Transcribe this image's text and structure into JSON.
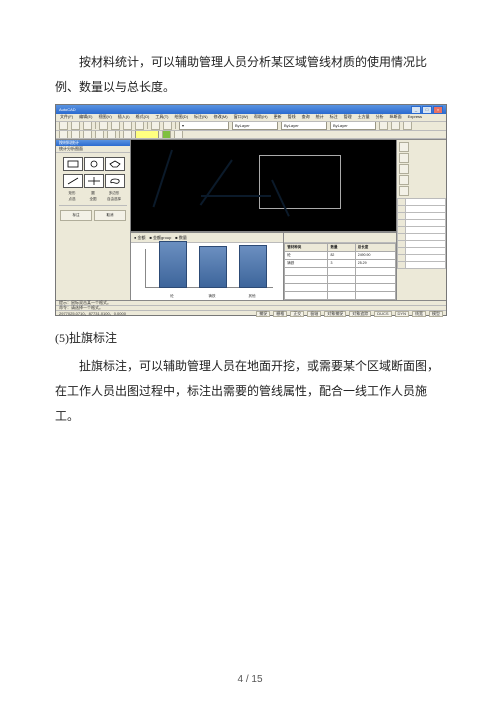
{
  "document": {
    "para1": "按材料统计，可以辅助管理人员分析某区域管线材质的使用情况比例、数量以与总长度。",
    "section_label": "(5)扯旗标注",
    "para2": "扯旗标注，可以辅助管理人员在地面开挖，或需要某个区域断面图，在工作人员出图过程中，标注出需要的管线属性，配合一线工作人员施工。",
    "page_number": "4 / 15"
  },
  "app": {
    "title": "AutoCAD",
    "window_buttons": [
      "_",
      "□",
      "×"
    ],
    "menu": [
      "文件(F)",
      "编辑(E)",
      "视图(V)",
      "插入(I)",
      "格式(O)",
      "工具(T)",
      "绘图(D)",
      "标注(N)",
      "修改(M)",
      "窗口(W)",
      "帮助(H)",
      "更新",
      "管线",
      "查询",
      "统计",
      "标注",
      "管理",
      "土方量",
      "分析",
      "纵断面",
      "Express"
    ],
    "toolbar1_fields": {
      "linetype": "ByLayer",
      "lineweight": "ByLayer",
      "color": "ByLayer"
    },
    "left_panel": {
      "title": "按材料统计",
      "tab": "统计分析图面",
      "row1": [
        "矩形",
        "圆",
        "多边形"
      ],
      "row2": [
        "点选",
        "全图",
        "自由选择"
      ],
      "btn_title_row": [
        "标注",
        "取消"
      ]
    },
    "chart": {
      "tabs": [
        "金额",
        "■ 金额group",
        "■ 数量"
      ],
      "note": "提示：鼠标双击某一个格式。"
    },
    "data_table": {
      "headers": [
        "管材种类",
        "数量",
        "总长度"
      ],
      "rows": [
        [
          "砼",
          "82",
          "2490.90"
        ],
        [
          "铸铁",
          "3",
          "25.29"
        ]
      ]
    },
    "right_panel": {
      "selected": "ByLayer"
    },
    "status": {
      "cmd_hint": "命令：请选择一个格式。",
      "coords": "2977025.0710、87731.0100、0.0000",
      "toggles": [
        "捕捉",
        "栅格",
        "正交",
        "极轴",
        "对象捕捉",
        "对象追踪",
        "DUCS",
        "DYN",
        "线宽",
        "模型"
      ]
    }
  },
  "chart_data": {
    "type": "bar",
    "title": "",
    "categories": [
      "砼",
      "铸铁",
      "其他"
    ],
    "values": [
      54,
      48,
      50
    ],
    "xlabel": "",
    "ylabel": "",
    "ylim": [
      0,
      60
    ]
  }
}
